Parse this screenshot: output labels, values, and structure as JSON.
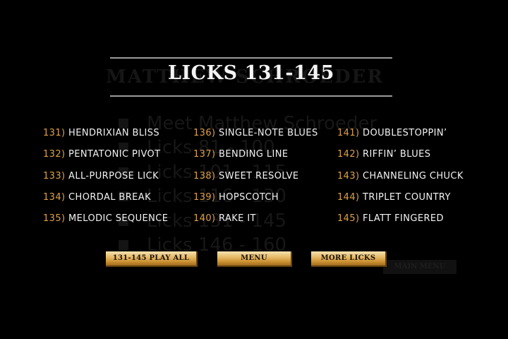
{
  "title": "LICKS 131-145",
  "ghost": {
    "title": "MATTHEW SCHROEDER",
    "lines": [
      "Meet Matthew Schroeder",
      "Licks 81 - 100",
      "Licks 101 - 115",
      "Licks 116 - 130",
      "Licks 131 - 145",
      "Licks 146 - 160"
    ],
    "button": "MAIN MENU"
  },
  "licks": [
    {
      "num": "131)",
      "name": "HENDRIXIAN BLISS"
    },
    {
      "num": "132)",
      "name": "PENTATONIC PIVOT"
    },
    {
      "num": "133)",
      "name": "ALL-PURPOSE LICK"
    },
    {
      "num": "134)",
      "name": "CHORDAL BREAK"
    },
    {
      "num": "135)",
      "name": "MELODIC SEQUENCE"
    },
    {
      "num": "136)",
      "name": "SINGLE-NOTE BLUES"
    },
    {
      "num": "137)",
      "name": "BENDING LINE"
    },
    {
      "num": "138)",
      "name": "SWEET RESOLVE"
    },
    {
      "num": "139)",
      "name": "HOPSCOTCH"
    },
    {
      "num": "140)",
      "name": "RAKE IT"
    },
    {
      "num": "141)",
      "name": "DOUBLESTOPPIN’"
    },
    {
      "num": "142)",
      "name": "RIFFIN’ BLUES"
    },
    {
      "num": "143)",
      "name": "CHANNELING CHUCK"
    },
    {
      "num": "144)",
      "name": "TRIPLET COUNTRY"
    },
    {
      "num": "145)",
      "name": "FLATT FINGERED"
    }
  ],
  "buttons": {
    "play_all": "131-145 PLAY ALL",
    "menu": "MENU",
    "more_licks": "MORE LICKS"
  },
  "colors": {
    "background": "#000000",
    "number": "#e0a040",
    "text": "#f2f2f2",
    "rule": "#9a9a9a",
    "button_gold": "#e6bb6a"
  }
}
